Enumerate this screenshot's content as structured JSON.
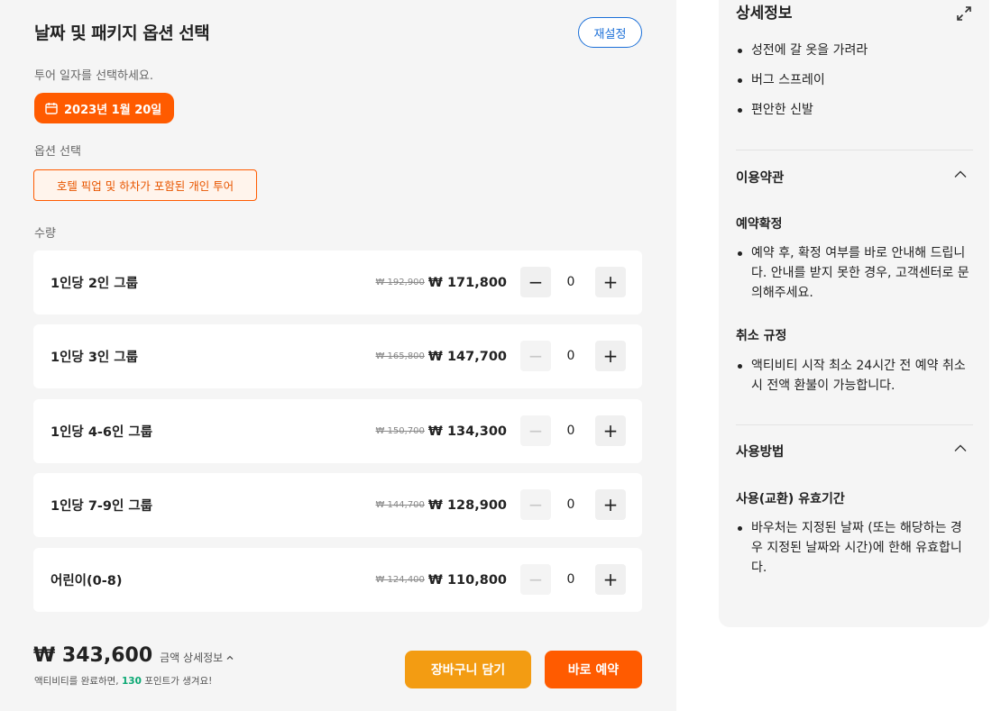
{
  "left": {
    "title": "날짜 및 패키지 옵션 선택",
    "reset_label": "재설정",
    "date_prompt": "투어 일자를 선택하세요.",
    "selected_date": "2023년 1월 20일",
    "option_label": "옵션 선택",
    "selected_option": "호텔 픽업 및 하차가 포함된 개인 투어",
    "quantity_label": "수량",
    "rows": [
      {
        "name": "1인당 2인 그룹",
        "old_price": "₩ 192,900",
        "price": "₩ 171,800",
        "qty": "0"
      },
      {
        "name": "1인당 3인 그룹",
        "old_price": "₩ 165,800",
        "price": "₩ 147,700",
        "qty": "0"
      },
      {
        "name": "1인당 4-6인 그룹",
        "old_price": "₩ 150,700",
        "price": "₩ 134,300",
        "qty": "0"
      },
      {
        "name": "1인당 7-9인 그룹",
        "old_price": "₩ 144,700",
        "price": "₩ 128,900",
        "qty": "0"
      },
      {
        "name": "어린이(0-8)",
        "old_price": "₩ 124,400",
        "price": "₩ 110,800",
        "qty": "0"
      }
    ],
    "total_amount": "₩ 343,600",
    "total_detail": "금액 상세정보",
    "points_prefix": "액티비티를 완료하면, ",
    "points_value": "130",
    "points_suffix": " 포인트가 생겨요!",
    "cart_label": "장바구니 담기",
    "book_label": "바로 예약"
  },
  "right": {
    "title": "상세정보",
    "items": [
      "성전에 갈 옷을 가려라",
      "버그 스프레이",
      "편안한 신발"
    ],
    "terms": {
      "heading": "이용약관",
      "confirm_heading": "예약확정",
      "confirm_text": "예약 후, 확정 여부를 바로 안내해 드립니다. 안내를 받지 못한 경우, 고객센터로 문의해주세요.",
      "cancel_heading": "취소 규정",
      "cancel_text": "액티비티 시작 최소 24시간 전 예약 취소시 전액 환불이 가능합니다."
    },
    "usage": {
      "heading": "사용방법",
      "validity_heading": "사용(교환) 유효기간",
      "validity_text": "바우처는 지정된 날짜 (또는 해당하는 경우 지정된 날짜와 시간)에 한해 유효합니다."
    }
  },
  "colors": {
    "accent": "#ff5b00",
    "cart": "#f39c12",
    "link": "#1a6fd8",
    "points": "#0aa873"
  }
}
